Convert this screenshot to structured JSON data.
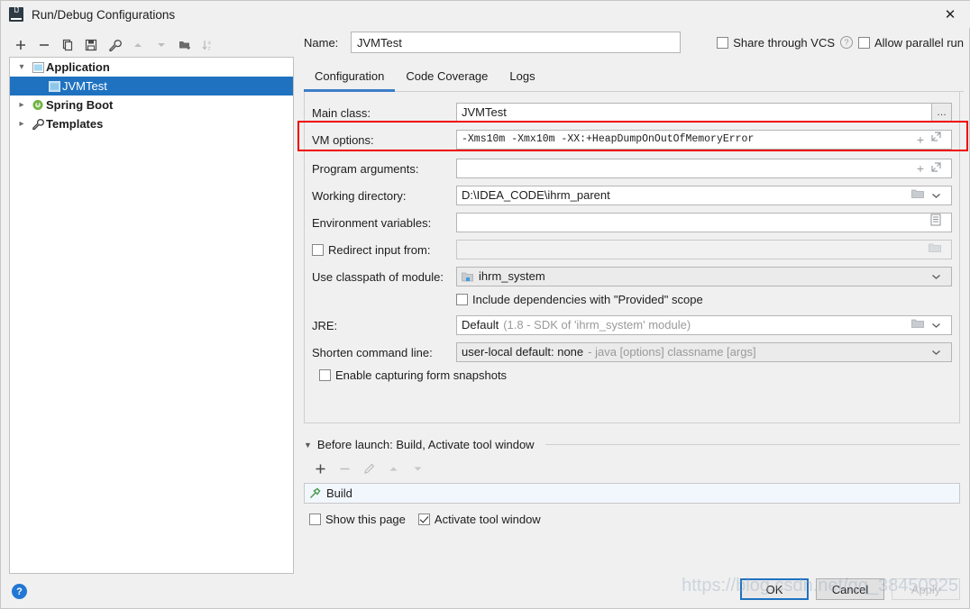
{
  "window": {
    "title": "Run/Debug Configurations",
    "app_icon": "intellij-idea-icon",
    "close_icon": "✕"
  },
  "left_toolbar": {
    "buttons": [
      {
        "name": "add-configuration-button",
        "icon": "plus-icon",
        "enabled": true
      },
      {
        "name": "remove-configuration-button",
        "icon": "minus-icon",
        "enabled": true
      },
      {
        "name": "copy-configuration-button",
        "icon": "copy-icon",
        "enabled": true
      },
      {
        "name": "save-configuration-button",
        "icon": "save-icon",
        "enabled": true
      },
      {
        "name": "edit-templates-button",
        "icon": "wrench-icon",
        "enabled": true
      },
      {
        "name": "move-up-button",
        "icon": "arrow-up-icon",
        "enabled": false
      },
      {
        "name": "move-down-button",
        "icon": "arrow-down-icon",
        "enabled": false
      },
      {
        "name": "create-folder-button",
        "icon": "folder-add-icon",
        "enabled": true
      },
      {
        "name": "sort-configurations-button",
        "icon": "sort-alpha-icon",
        "enabled": false
      }
    ]
  },
  "tree": {
    "items": [
      {
        "label": "Application",
        "icon": "application-icon",
        "twisty": "expanded",
        "level": 0,
        "selected": false
      },
      {
        "label": "JVMTest",
        "icon": "application-icon",
        "twisty": "none",
        "level": 1,
        "selected": true
      },
      {
        "label": "Spring Boot",
        "icon": "spring-boot-icon",
        "twisty": "collapsed",
        "level": 0,
        "selected": false
      },
      {
        "label": "Templates",
        "icon": "wrench-icon",
        "twisty": "collapsed",
        "level": 0,
        "selected": false
      }
    ]
  },
  "name_row": {
    "label": "Name:",
    "value": "JVMTest",
    "placeholder": "",
    "share_through_vcs": {
      "label": "Share through VCS",
      "checked": false
    },
    "help_icon": "?",
    "allow_parallel_run": {
      "label": "Allow parallel run",
      "checked": false
    }
  },
  "tabs": [
    {
      "label": "Configuration",
      "active": true
    },
    {
      "label": "Code Coverage",
      "active": false
    },
    {
      "label": "Logs",
      "active": false
    }
  ],
  "form": {
    "main_class": {
      "label": "Main class:",
      "value": "JVMTest",
      "browse_icon": "…"
    },
    "vm_options": {
      "label": "VM options:",
      "value": "-Xms10m -Xmx10m -XX:+HeapDumpOnOutOfMemoryError",
      "add_icon": "+",
      "expand_icon": "expand-icon",
      "highlighted": true,
      "highlight_color": "#ef0000"
    },
    "program_arguments": {
      "label": "Program arguments:",
      "value": "",
      "add_icon": "+",
      "expand_icon": "expand-icon"
    },
    "working_directory": {
      "label": "Working directory:",
      "value": "D:\\IDEA_CODE\\ihrm_parent",
      "folder_icon": "folder-icon",
      "dropdown_icon": "chevron-down-icon"
    },
    "environment_variables": {
      "label": "Environment variables:",
      "value": "",
      "edit_icon": "list-edit-icon"
    },
    "redirect_input_from": {
      "label": "Redirect input from:",
      "checked": false,
      "value": "",
      "disabled": true,
      "folder_icon": "folder-icon"
    },
    "use_classpath_of_module": {
      "label": "Use classpath of module:",
      "value": "ihrm_system",
      "module_icon": "module-icon",
      "dropdown_icon": "chevron-down-icon"
    },
    "include_provided_scope": {
      "label": "Include dependencies with \"Provided\" scope",
      "checked": false
    },
    "jre": {
      "label": "JRE:",
      "value": "Default",
      "value_note": "(1.8 - SDK of 'ihrm_system' module)",
      "folder_icon": "folder-icon",
      "dropdown_icon": "chevron-down-icon"
    },
    "shorten_command_line": {
      "label": "Shorten command line:",
      "value": "user-local default: none",
      "value_note": "- java [options] classname [args]",
      "dropdown_icon": "chevron-down-icon"
    },
    "enable_capturing_form_snapshots": {
      "label": "Enable capturing form snapshots",
      "checked": false
    }
  },
  "before_launch": {
    "header": "Before launch: Build, Activate tool window",
    "caret_icon": "caret-down-icon",
    "toolbar": [
      {
        "name": "add-task-button",
        "icon": "plus-icon",
        "enabled": true
      },
      {
        "name": "remove-task-button",
        "icon": "minus-icon",
        "enabled": false
      },
      {
        "name": "edit-task-button",
        "icon": "pencil-icon",
        "enabled": false
      },
      {
        "name": "move-task-up-button",
        "icon": "arrow-up-icon",
        "enabled": false
      },
      {
        "name": "move-task-down-button",
        "icon": "arrow-down-icon",
        "enabled": false
      }
    ],
    "items": [
      {
        "label": "Build",
        "icon": "hammer-icon"
      }
    ],
    "show_this_page": {
      "label": "Show this page",
      "checked": false
    },
    "activate_tool_window": {
      "label": "Activate tool window",
      "checked": true
    }
  },
  "footer": {
    "help_icon": "?",
    "buttons": [
      {
        "label": "OK",
        "style": "default",
        "enabled": true
      },
      {
        "label": "Cancel",
        "style": "normal",
        "enabled": true
      },
      {
        "label": "Apply",
        "style": "disabled",
        "enabled": false
      }
    ]
  },
  "watermark": {
    "text": "https://blog.csdn.net/qq_38450925"
  },
  "colors": {
    "selection_blue": "#1f72c0",
    "tab_underline": "#3d7dc9",
    "highlight_red": "#ef0000",
    "dialog_bg": "#f0f0f0",
    "panel_bg": "#ffffff"
  }
}
